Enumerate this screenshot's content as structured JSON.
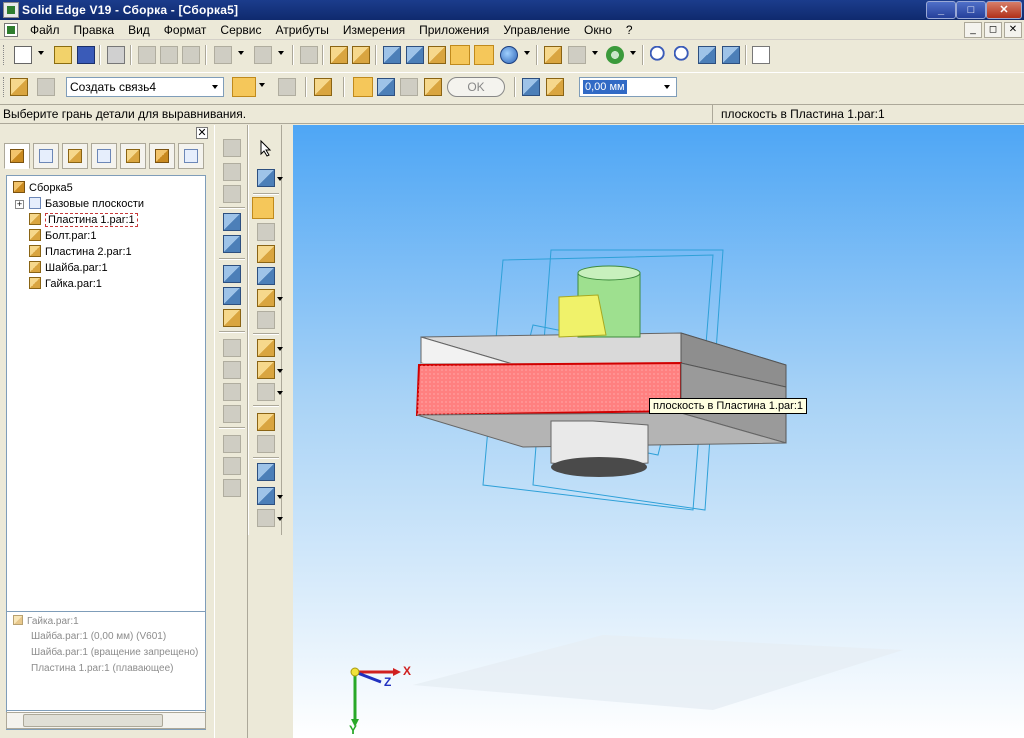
{
  "window": {
    "title": "Solid Edge V19 - Сборка - [Сборка5]",
    "minimize": "_",
    "maximize": "□",
    "close": "✕"
  },
  "menu": [
    "Файл",
    "Правка",
    "Вид",
    "Формат",
    "Сервис",
    "Атрибуты",
    "Измерения",
    "Приложения",
    "Управление",
    "Окно",
    "?"
  ],
  "mdi_controls": [
    "_",
    "◻",
    "✕"
  ],
  "command_bar": {
    "relation_select": "Создать связь4",
    "ok_label": "OK",
    "offset_value": "0,00 мм"
  },
  "prompt": {
    "message": "Выберите грань детали для выравнивания.",
    "status": "плоскость в Пластина 1.par:1"
  },
  "panel": {
    "close": "✕",
    "tree": {
      "root": "Сборка5",
      "items": [
        {
          "label": "Базовые плоскости",
          "icon": "planes-icon"
        },
        {
          "label": "Пластина 1.par:1",
          "icon": "part-icon",
          "selected": true
        },
        {
          "label": "Болт.par:1",
          "icon": "part-icon"
        },
        {
          "label": "Пластина 2.par:1",
          "icon": "part-icon"
        },
        {
          "label": "Шайба.par:1",
          "icon": "part-icon"
        },
        {
          "label": "Гайка.par:1",
          "icon": "part-icon"
        }
      ]
    },
    "relationships": {
      "title": "Гайка.par:1",
      "items": [
        {
          "label": "Шайба.par:1   (0,00 мм)   (V601)"
        },
        {
          "label": "Шайба.par:1   (вращение запрещено)"
        },
        {
          "label": "Пластина 1.par:1   (плавающее)"
        }
      ]
    }
  },
  "viewport": {
    "tooltip": "плоскость в Пластина 1.par:1",
    "axes": {
      "x": "X",
      "y": "Y",
      "z": "Z"
    },
    "highlight_color": "#ff6060",
    "background_top": "#4ea6f5"
  }
}
